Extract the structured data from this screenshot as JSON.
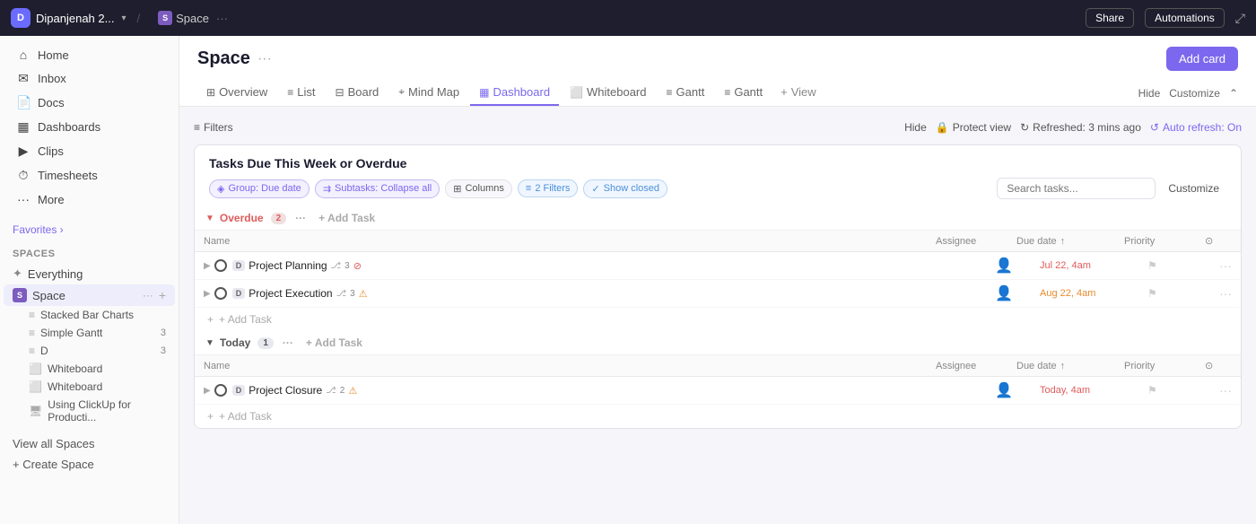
{
  "topbar": {
    "workspace_initial": "D",
    "workspace_name": "Dipanjenah 2...",
    "space_initial": "S",
    "space_label": "Space",
    "more_icon": "···",
    "share_label": "Share",
    "automations_label": "Automations"
  },
  "sidebar": {
    "nav_items": [
      {
        "id": "home",
        "icon": "⌂",
        "label": "Home"
      },
      {
        "id": "inbox",
        "icon": "✉",
        "label": "Inbox"
      },
      {
        "id": "docs",
        "icon": "📄",
        "label": "Docs"
      },
      {
        "id": "dashboards",
        "icon": "▦",
        "label": "Dashboards"
      },
      {
        "id": "clips",
        "icon": "▶",
        "label": "Clips"
      },
      {
        "id": "timesheets",
        "icon": "⏱",
        "label": "Timesheets"
      },
      {
        "id": "more",
        "icon": "···",
        "label": "More"
      }
    ],
    "favorites_label": "Favorites ›",
    "spaces_label": "Spaces",
    "spaces": [
      {
        "id": "everything",
        "icon": "✦",
        "label": "Everything",
        "active": false,
        "count": null
      },
      {
        "id": "space",
        "icon": "S",
        "label": "Space",
        "active": true,
        "count": null
      },
      {
        "id": "stacked-bar-charts",
        "icon": "≡",
        "label": "Stacked Bar Charts",
        "sub": true,
        "count": null
      },
      {
        "id": "simple-gantt",
        "icon": "≡",
        "label": "Simple Gantt",
        "sub": true,
        "count": 3
      },
      {
        "id": "d",
        "icon": "≡",
        "label": "D",
        "sub": true,
        "count": 3
      },
      {
        "id": "whiteboard1",
        "icon": "⬜",
        "label": "Whiteboard",
        "sub": true,
        "count": null
      },
      {
        "id": "whiteboard2",
        "icon": "⬜",
        "label": "Whiteboard",
        "sub": true,
        "count": null
      },
      {
        "id": "using-clickup",
        "icon": "🖥",
        "label": "Using ClickUp for Producti...",
        "sub": true,
        "count": null
      }
    ],
    "bottom_items": [
      {
        "id": "view-all-spaces",
        "label": "View all Spaces"
      },
      {
        "id": "create-space",
        "label": "+ Create Space"
      }
    ]
  },
  "content": {
    "page_title": "Space",
    "more_icon": "···",
    "add_card_label": "Add card",
    "tabs": [
      {
        "id": "overview",
        "icon": "⊞",
        "label": "Overview"
      },
      {
        "id": "list",
        "icon": "≡",
        "label": "List"
      },
      {
        "id": "board",
        "icon": "⊟",
        "label": "Board"
      },
      {
        "id": "mindmap",
        "icon": "⌖",
        "label": "Mind Map"
      },
      {
        "id": "dashboard",
        "icon": "▦",
        "label": "Dashboard",
        "active": true
      },
      {
        "id": "whiteboard",
        "icon": "⬜",
        "label": "Whiteboard"
      },
      {
        "id": "gantt1",
        "icon": "≡",
        "label": "Gantt"
      },
      {
        "id": "gantt2",
        "icon": "≡",
        "label": "Gantt"
      },
      {
        "id": "view",
        "icon": "+",
        "label": "View"
      }
    ],
    "tab_actions": {
      "hide_label": "Hide",
      "customize_label": "Customize",
      "collapse_icon": "⌃"
    }
  },
  "dashboard": {
    "filter_label": "Filters",
    "hide_label": "Hide",
    "protect_view_label": "Protect view",
    "refreshed_label": "Refreshed: 3 mins ago",
    "auto_refresh_label": "Auto refresh: On",
    "card": {
      "title": "Tasks Due This Week or Overdue",
      "chips": [
        {
          "id": "group-due-date",
          "label": "Group: Due date",
          "type": "purple"
        },
        {
          "id": "subtasks-collapse",
          "label": "Subtasks: Collapse all",
          "type": "purple"
        },
        {
          "id": "columns",
          "label": "Columns",
          "type": "default"
        },
        {
          "id": "filters",
          "label": "2 Filters",
          "type": "blue"
        },
        {
          "id": "show-closed",
          "label": "Show closed",
          "type": "blue"
        }
      ],
      "search_placeholder": "Search tasks...",
      "customize_label": "Customize",
      "groups": [
        {
          "id": "overdue",
          "label": "Overdue",
          "count": 2,
          "type": "overdue",
          "add_task_label": "+ Add Task",
          "columns": [
            "Name",
            "Assignee",
            "Due date",
            "Priority"
          ],
          "tasks": [
            {
              "id": "project-planning",
              "d_badge": "D",
              "name": "Project Planning",
              "subtask_icon": "⎇",
              "subtask_count": 3,
              "warning_icon": "⊘",
              "assignee": "👤",
              "due_date": "Jul 22, 4am",
              "due_type": "overdue",
              "priority_flag": "⚑",
              "more": "···"
            },
            {
              "id": "project-execution",
              "d_badge": "D",
              "name": "Project Execution",
              "subtask_icon": "⎇",
              "subtask_count": 3,
              "warning_icon": "⚠",
              "assignee": "👤",
              "due_date": "Aug 22, 4am",
              "due_type": "aug",
              "priority_flag": "⚑",
              "more": "···"
            }
          ],
          "add_task_footer": "+ Add Task"
        },
        {
          "id": "today",
          "label": "Today",
          "count": 1,
          "type": "today",
          "add_task_label": "+ Add Task",
          "columns": [
            "Name",
            "Assignee",
            "Due date",
            "Priority"
          ],
          "tasks": [
            {
              "id": "project-closure",
              "d_badge": "D",
              "name": "Project Closure",
              "subtask_icon": "⎇",
              "subtask_count": 2,
              "warning_icon": "⚠",
              "assignee": "👤",
              "due_date": "Today, 4am",
              "due_type": "today",
              "priority_flag": "⚑",
              "more": "···"
            }
          ],
          "add_task_footer": "+ Add Task"
        }
      ]
    }
  }
}
